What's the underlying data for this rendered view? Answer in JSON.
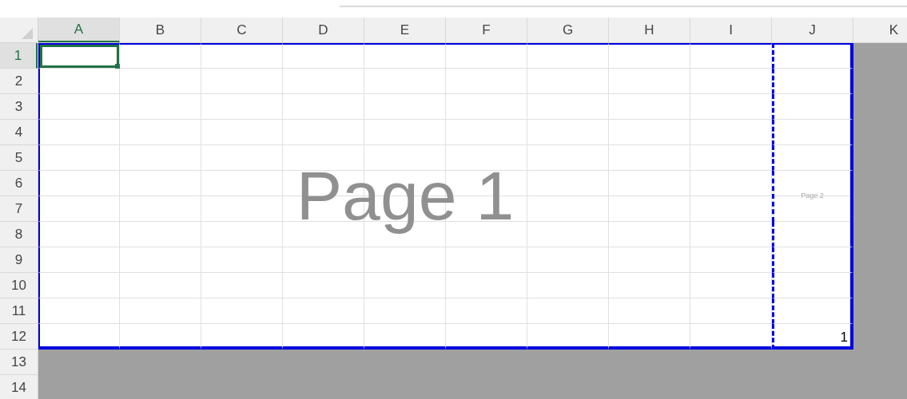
{
  "columns": [
    {
      "label": "A",
      "selected": true,
      "in_print_area": true,
      "page_break_before": false
    },
    {
      "label": "B",
      "selected": false,
      "in_print_area": true,
      "page_break_before": false
    },
    {
      "label": "C",
      "selected": false,
      "in_print_area": true,
      "page_break_before": false
    },
    {
      "label": "D",
      "selected": false,
      "in_print_area": true,
      "page_break_before": false
    },
    {
      "label": "E",
      "selected": false,
      "in_print_area": true,
      "page_break_before": false
    },
    {
      "label": "F",
      "selected": false,
      "in_print_area": true,
      "page_break_before": false
    },
    {
      "label": "G",
      "selected": false,
      "in_print_area": true,
      "page_break_before": false
    },
    {
      "label": "H",
      "selected": false,
      "in_print_area": true,
      "page_break_before": false
    },
    {
      "label": "I",
      "selected": false,
      "in_print_area": true,
      "page_break_before": false
    },
    {
      "label": "J",
      "selected": false,
      "in_print_area": true,
      "page_break_before": true
    },
    {
      "label": "K",
      "selected": false,
      "in_print_area": false
    }
  ],
  "rows": [
    {
      "label": "1",
      "selected": true,
      "in_print_area": true
    },
    {
      "label": "2",
      "selected": false,
      "in_print_area": true
    },
    {
      "label": "3",
      "selected": false,
      "in_print_area": true
    },
    {
      "label": "4",
      "selected": false,
      "in_print_area": true
    },
    {
      "label": "5",
      "selected": false,
      "in_print_area": true
    },
    {
      "label": "6",
      "selected": false,
      "in_print_area": true
    },
    {
      "label": "7",
      "selected": false,
      "in_print_area": true
    },
    {
      "label": "8",
      "selected": false,
      "in_print_area": true
    },
    {
      "label": "9",
      "selected": false,
      "in_print_area": true
    },
    {
      "label": "10",
      "selected": false,
      "in_print_area": true
    },
    {
      "label": "11",
      "selected": false,
      "in_print_area": true
    },
    {
      "label": "12",
      "selected": false,
      "in_print_area": true,
      "last_cell_value": "1"
    },
    {
      "label": "13",
      "selected": false,
      "in_print_area": false
    },
    {
      "label": "14",
      "selected": false,
      "in_print_area": false
    }
  ],
  "pages": [
    {
      "label": "Page 1"
    },
    {
      "label": "Page 2"
    }
  ]
}
